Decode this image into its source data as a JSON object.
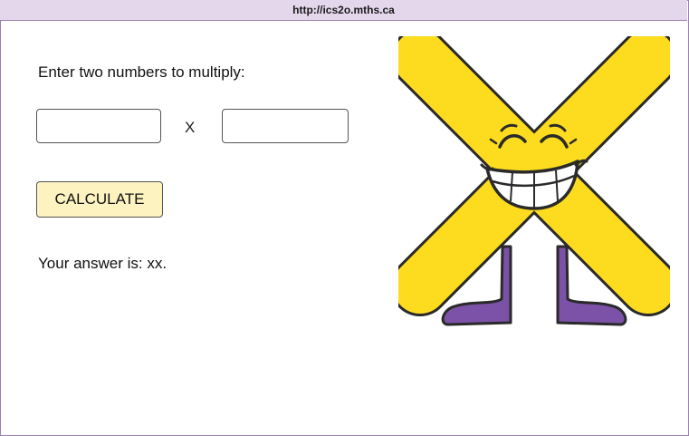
{
  "browser": {
    "url": "http://ics2o.mths.ca"
  },
  "form": {
    "prompt": "Enter two numbers to multiply:",
    "first_value": "",
    "second_value": "",
    "operator": "X",
    "calculate_label": "CALCULATE",
    "answer_text": "Your answer is: xx."
  },
  "illustration": {
    "icon": "smiling-multiplication-x-mascot-icon",
    "colors": {
      "body": "#fddc1f",
      "outline": "#2a2a2a",
      "legs": "#7b52a8"
    }
  }
}
